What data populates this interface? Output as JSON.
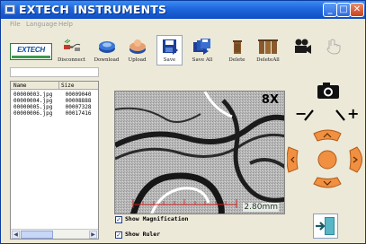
{
  "window": {
    "title": "EXTECH INSTRUMENTS",
    "controls": {
      "minimize": "_",
      "maximize": "□",
      "close": "✕"
    }
  },
  "menu": {
    "items": [
      "File",
      "Language",
      "Help"
    ]
  },
  "logo": {
    "text": "EXTECH"
  },
  "toolbar": {
    "buttons": [
      {
        "label": "Disconnect",
        "icon": "connection-icon"
      },
      {
        "label": "Download",
        "icon": "download-icon"
      },
      {
        "label": "Upload",
        "icon": "upload-icon"
      },
      {
        "label": "Save",
        "icon": "save-icon",
        "selected": true
      },
      {
        "label": "Save All",
        "icon": "save-all-icon"
      },
      {
        "label": "Delete",
        "icon": "trash-icon"
      },
      {
        "label": "DeleteAll",
        "icon": "trash-all-icon"
      },
      {
        "label": "",
        "icon": "video-camera-icon"
      },
      {
        "label": "",
        "icon": "hand-pointer-icon"
      }
    ]
  },
  "file_list": {
    "columns": [
      "Name",
      "Size"
    ],
    "rows": [
      {
        "name": "00000003.jpg",
        "size": "00009040"
      },
      {
        "name": "00000004.jpg",
        "size": "00008888"
      },
      {
        "name": "00000005.jpg",
        "size": "00007328"
      },
      {
        "name": "00000006.jpg",
        "size": "00017416"
      }
    ],
    "scroll_left": "◀",
    "scroll_right": "▶"
  },
  "viewer": {
    "zoom": "8X",
    "ruler_reading": "2.80mm"
  },
  "options": {
    "show_magnification": {
      "label": "Show Magnification",
      "checked": true
    },
    "show_ruler": {
      "label": "Show Ruler",
      "checked": true
    }
  },
  "controls": {
    "capture": "camera-icon",
    "zoom_out": "−",
    "zoom_in": "+",
    "pad_center": "center-button"
  },
  "colors": {
    "titlebar": "#1f66dc",
    "pad": "#f09040",
    "ruler": "#d02020"
  }
}
